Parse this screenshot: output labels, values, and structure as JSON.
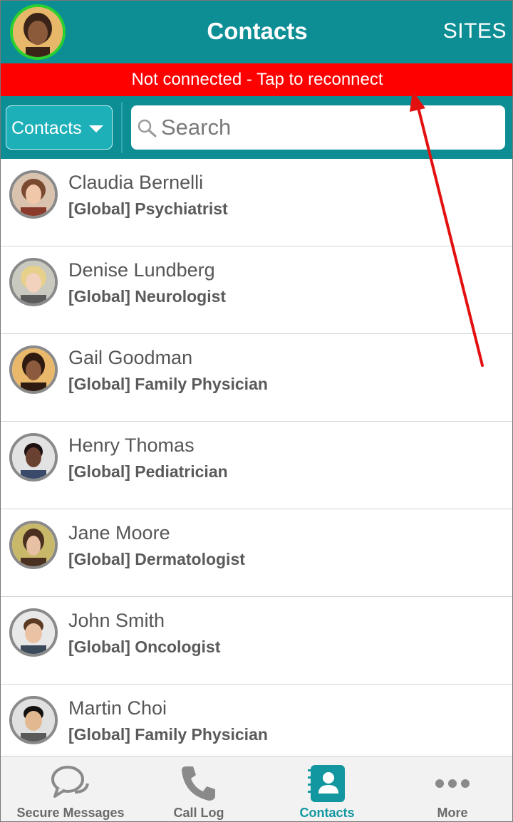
{
  "header": {
    "title": "Contacts",
    "sites_label": "SITES"
  },
  "banner": {
    "text": "Not connected - Tap to reconnect"
  },
  "filter": {
    "dropdown_label": "Contacts",
    "search_placeholder": "Search"
  },
  "contacts": [
    {
      "name": "Claudia Bernelli",
      "role": "[Global] Psychiatrist"
    },
    {
      "name": "Denise Lundberg",
      "role": "[Global] Neurologist"
    },
    {
      "name": "Gail Goodman",
      "role": "[Global] Family Physician"
    },
    {
      "name": "Henry Thomas",
      "role": "[Global] Pediatrician"
    },
    {
      "name": "Jane Moore",
      "role": "[Global] Dermatologist"
    },
    {
      "name": "John Smith",
      "role": "[Global] Oncologist"
    },
    {
      "name": "Martin Choi",
      "role": "[Global] Family Physician"
    }
  ],
  "tabs": [
    {
      "label": "Secure Messages",
      "icon": "chat-bubbles-icon"
    },
    {
      "label": "Call Log",
      "icon": "phone-icon"
    },
    {
      "label": "Contacts",
      "icon": "contacts-book-icon",
      "active": true
    },
    {
      "label": "More",
      "icon": "more-dots-icon"
    }
  ],
  "colors": {
    "header_bg": "#0d8e95",
    "banner_bg": "#ff0000",
    "active_tab": "#1297a0",
    "annotation_arrow": "#e31010"
  }
}
